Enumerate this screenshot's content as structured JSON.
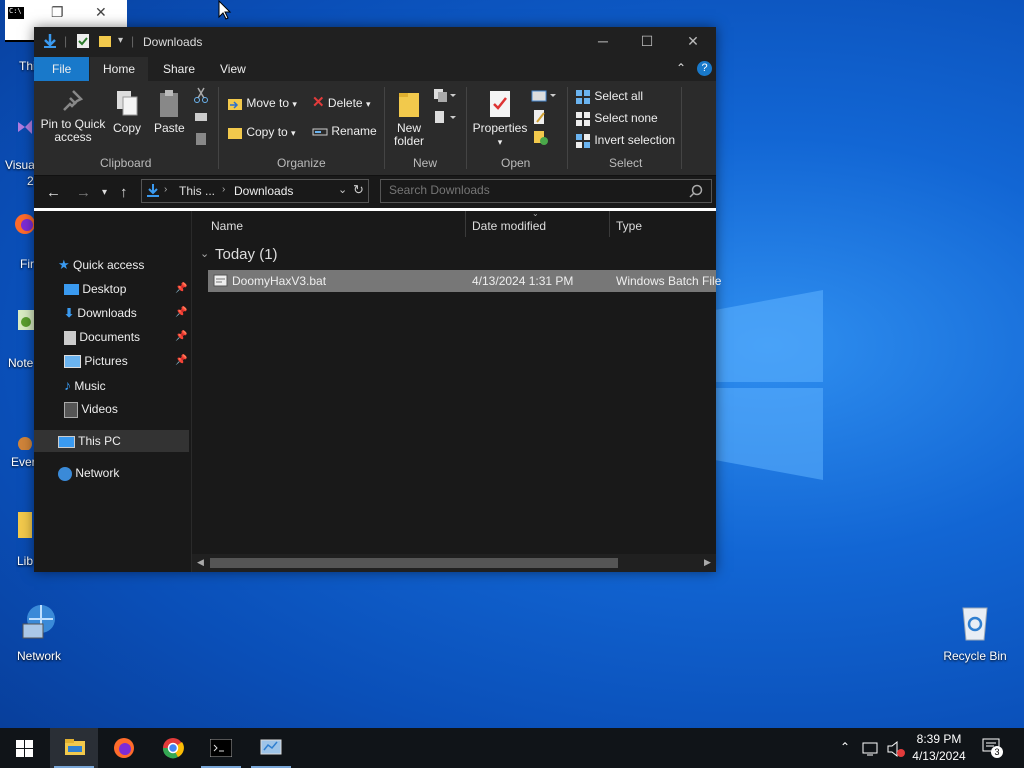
{
  "desktop": {
    "icons": [
      {
        "name": "Network"
      },
      {
        "name": "Recycle Bin"
      }
    ],
    "partial_labels": [
      "Thi",
      "Visua",
      "2",
      "Fir",
      "Note",
      "Ever",
      "Lib"
    ]
  },
  "explorer": {
    "title": "Downloads",
    "tabs": [
      "File",
      "Home",
      "Share",
      "View"
    ],
    "ribbon": {
      "clipboard": {
        "pin": "Pin to Quick access",
        "copy": "Copy",
        "paste": "Paste",
        "group": "Clipboard"
      },
      "organize": {
        "move_to": "Move to",
        "copy_to": "Copy to",
        "delete": "Delete",
        "rename": "Rename",
        "group": "Organize"
      },
      "new": {
        "new_folder": "New folder",
        "group": "New"
      },
      "open": {
        "properties": "Properties",
        "group": "Open"
      },
      "select": {
        "select_all": "Select all",
        "select_none": "Select none",
        "invert": "Invert selection",
        "group": "Select"
      }
    },
    "address": {
      "crumb1": "This ...",
      "crumb2": "Downloads"
    },
    "search_placeholder": "Search Downloads",
    "nav": {
      "quick_access": "Quick access",
      "items": [
        "Desktop",
        "Downloads",
        "Documents",
        "Pictures",
        "Music",
        "Videos"
      ],
      "this_pc": "This PC",
      "network": "Network"
    },
    "columns": [
      "Name",
      "Date modified",
      "Type"
    ],
    "group_label": "Today (1)",
    "files": [
      {
        "name": "DoomyHaxV3.bat",
        "date": "4/13/2024 1:31 PM",
        "type": "Windows Batch File"
      }
    ]
  },
  "taskbar": {
    "time": "8:39 PM",
    "date": "4/13/2024",
    "notifications": "3"
  },
  "colors": {
    "accent": "#1979ca",
    "selection": "#777777",
    "taskbar": "#101418"
  }
}
